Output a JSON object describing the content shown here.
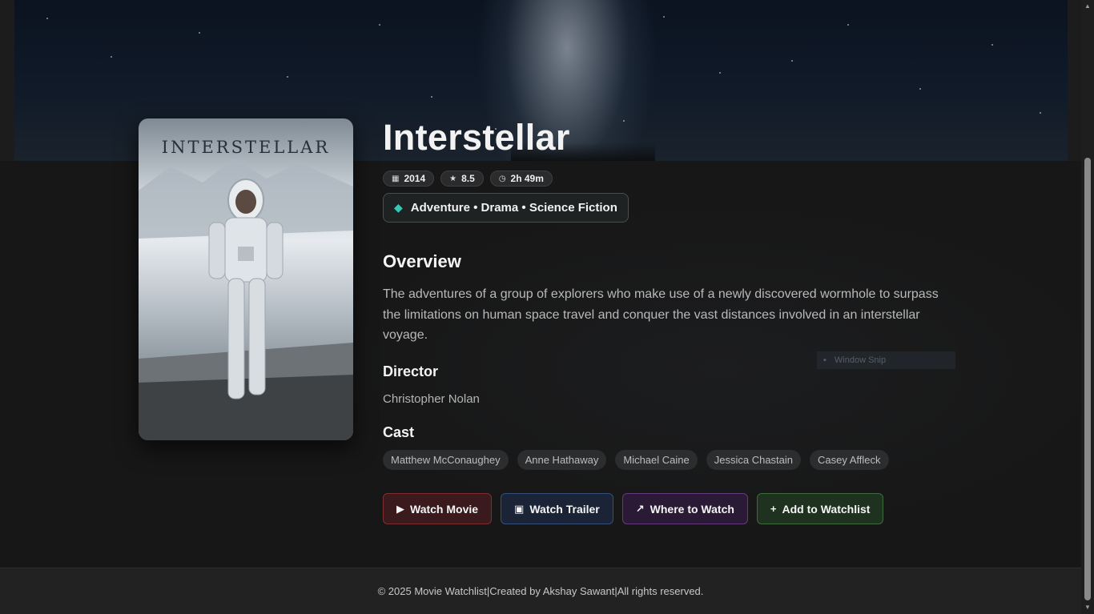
{
  "movie": {
    "title": "Interstellar",
    "poster_title": "INTERSTELLAR",
    "year": "2014",
    "rating": "8.5",
    "runtime": "2h 49m",
    "genres": "Adventure • Drama • Science Fiction",
    "overview_heading": "Overview",
    "overview": "The adventures of a group of explorers who make use of a newly discovered wormhole to surpass the limitations on human space travel and conquer the vast distances involved in an interstellar voyage.",
    "director_heading": "Director",
    "director": "Christopher Nolan",
    "cast_heading": "Cast",
    "cast": [
      "Matthew McConaughey",
      "Anne Hathaway",
      "Michael Caine",
      "Jessica Chastain",
      "Casey Affleck"
    ]
  },
  "icons": {
    "year": "calendar-icon",
    "rating": "star-icon",
    "runtime": "clock-icon",
    "genres": "tags-icon",
    "watch_movie": "play-icon",
    "watch_trailer": "film-icon",
    "where_to_watch": "external-link-icon",
    "add_to_watchlist": "plus-icon"
  },
  "actions": {
    "watch_movie": "Watch Movie",
    "watch_trailer": "Watch Trailer",
    "where_to_watch": "Where to Watch",
    "add_to_watchlist": "Add to Watchlist"
  },
  "overlay": {
    "window_snip": "Window Snip"
  },
  "footer": {
    "copyright": "© 2025 Movie Watchlist",
    "created_by": "Created by Akshay Sawant",
    "rights": "All rights reserved."
  },
  "colors": {
    "genre_icon": "#37c7b5",
    "watch_movie_border": "#7e2e31",
    "watch_trailer_border": "#34507a",
    "where_to_watch_border": "#643a7e",
    "add_to_watchlist_border": "#3e6a3d"
  }
}
